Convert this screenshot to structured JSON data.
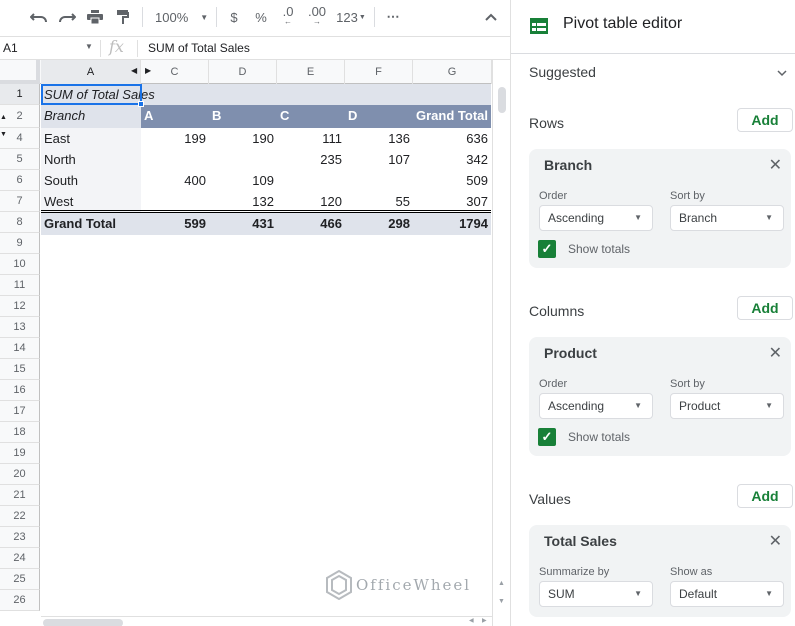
{
  "toolbar": {
    "zoom_level": "100%",
    "currency_label": "$",
    "percent_label": "%",
    "decrease_decimal_label": ".0",
    "increase_decimal_label": ".00",
    "number_format_label": "123",
    "more_label": "⋯",
    "icons": [
      "undo-icon",
      "redo-icon",
      "print-icon",
      "paint-format-icon",
      "collapse-icon"
    ]
  },
  "formula_bar": {
    "name_box": "A1",
    "fx_label": "fx",
    "formula": "SUM of Total Sales"
  },
  "sheet": {
    "columns": [
      "A",
      "C",
      "D",
      "E",
      "F",
      "G"
    ],
    "row_numbers": [
      "1",
      "2",
      "4",
      "5",
      "6",
      "7",
      "8",
      "9",
      "10",
      "11",
      "12",
      "13",
      "14",
      "15",
      "16",
      "17",
      "18",
      "19",
      "20",
      "21",
      "22",
      "23",
      "24",
      "25",
      "26"
    ],
    "pivot": {
      "title": "SUM of Total Sales",
      "row_field": "Branch",
      "column_headers": [
        "A",
        "B",
        "C",
        "D",
        "Grand Total"
      ],
      "rows": [
        {
          "label": "East",
          "values": [
            "199",
            "190",
            "111",
            "136",
            "636"
          ]
        },
        {
          "label": "North",
          "values": [
            "",
            "",
            "235",
            "107",
            "342"
          ]
        },
        {
          "label": "South",
          "values": [
            "400",
            "109",
            "",
            "",
            "509"
          ]
        },
        {
          "label": "West",
          "values": [
            "",
            "132",
            "120",
            "55",
            "307"
          ]
        }
      ],
      "grand_total": {
        "label": "Grand Total",
        "values": [
          "599",
          "431",
          "466",
          "298",
          "1794"
        ]
      }
    },
    "watermark": "OfficeWheel"
  },
  "editor": {
    "title": "Pivot table editor",
    "suggested_label": "Suggested",
    "add_label": "Add",
    "rows": {
      "label": "Rows",
      "field": "Branch",
      "order_label": "Order",
      "order_value": "Ascending",
      "sort_label": "Sort by",
      "sort_value": "Branch",
      "show_totals_label": "Show totals",
      "show_totals": true
    },
    "columns": {
      "label": "Columns",
      "field": "Product",
      "order_label": "Order",
      "order_value": "Ascending",
      "sort_label": "Sort by",
      "sort_value": "Product",
      "show_totals_label": "Show totals",
      "show_totals": true
    },
    "values": {
      "label": "Values",
      "field": "Total Sales",
      "summarize_label": "Summarize by",
      "summarize_value": "SUM",
      "show_as_label": "Show as",
      "show_as_value": "Default"
    }
  },
  "colors": {
    "accent_green": "#188038",
    "pivot_header": "#7f8fae",
    "pivot_light": "#dfe3eb",
    "selection_blue": "#1a73e8"
  }
}
